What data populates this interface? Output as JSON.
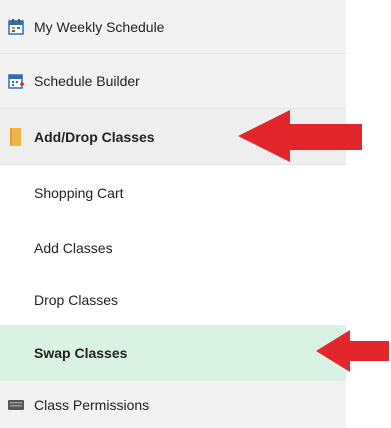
{
  "menu": {
    "items": [
      {
        "label": "My Weekly Schedule",
        "icon": "calendar-week-icon"
      },
      {
        "label": "Schedule Builder",
        "icon": "calendar-add-icon"
      },
      {
        "label": "Add/Drop Classes",
        "icon": "folder-icon"
      },
      {
        "label": "Shopping Cart"
      },
      {
        "label": "Add Classes"
      },
      {
        "label": "Drop Classes"
      },
      {
        "label": "Swap Classes"
      },
      {
        "label": "Class Permissions",
        "icon": "keyboard-icon"
      }
    ]
  },
  "colors": {
    "active_highlight": "#d9f2e3",
    "section_highlight": "#eeeeee",
    "arrow": "#e3262b"
  }
}
